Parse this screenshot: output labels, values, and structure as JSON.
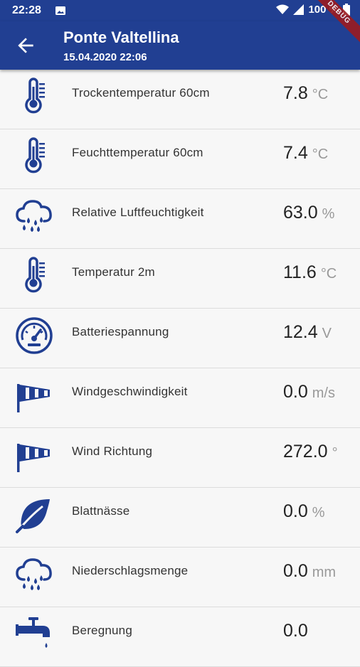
{
  "status_bar": {
    "time": "22:28",
    "battery": "100 %",
    "debug_banner": "DEBUG"
  },
  "header": {
    "title": "Ponte Valtellina",
    "subtitle": "15.04.2020 22:06"
  },
  "colors": {
    "primary": "#213f92",
    "icon": "#213f92",
    "background": "#f7f7f7",
    "divider": "#dcdcdc"
  },
  "sensors": [
    {
      "icon": "thermometer-icon",
      "label": "Trockentemperatur 60cm",
      "value": "7.8",
      "unit": "°C"
    },
    {
      "icon": "thermometer-icon",
      "label": "Feuchttemperatur 60cm",
      "value": "7.4",
      "unit": "°C"
    },
    {
      "icon": "cloud-rain-icon",
      "label": "Relative Luftfeuchtigkeit",
      "value": "63.0",
      "unit": "%"
    },
    {
      "icon": "thermometer-icon",
      "label": "Temperatur 2m",
      "value": "11.6",
      "unit": "°C"
    },
    {
      "icon": "gauge-icon",
      "label": "Batteriespannung",
      "value": "12.4",
      "unit": "V"
    },
    {
      "icon": "windsock-icon",
      "label": "Windgeschwindigkeit",
      "value": "0.0",
      "unit": "m/s"
    },
    {
      "icon": "windsock-icon",
      "label": "Wind Richtung",
      "value": "272.0",
      "unit": "°"
    },
    {
      "icon": "leaf-icon",
      "label": "Blattnässe",
      "value": "0.0",
      "unit": "%"
    },
    {
      "icon": "cloud-rain-icon",
      "label": "Niederschlagsmenge",
      "value": "0.0",
      "unit": "mm"
    },
    {
      "icon": "faucet-icon",
      "label": "Beregnung",
      "value": "0.0",
      "unit": ""
    }
  ]
}
